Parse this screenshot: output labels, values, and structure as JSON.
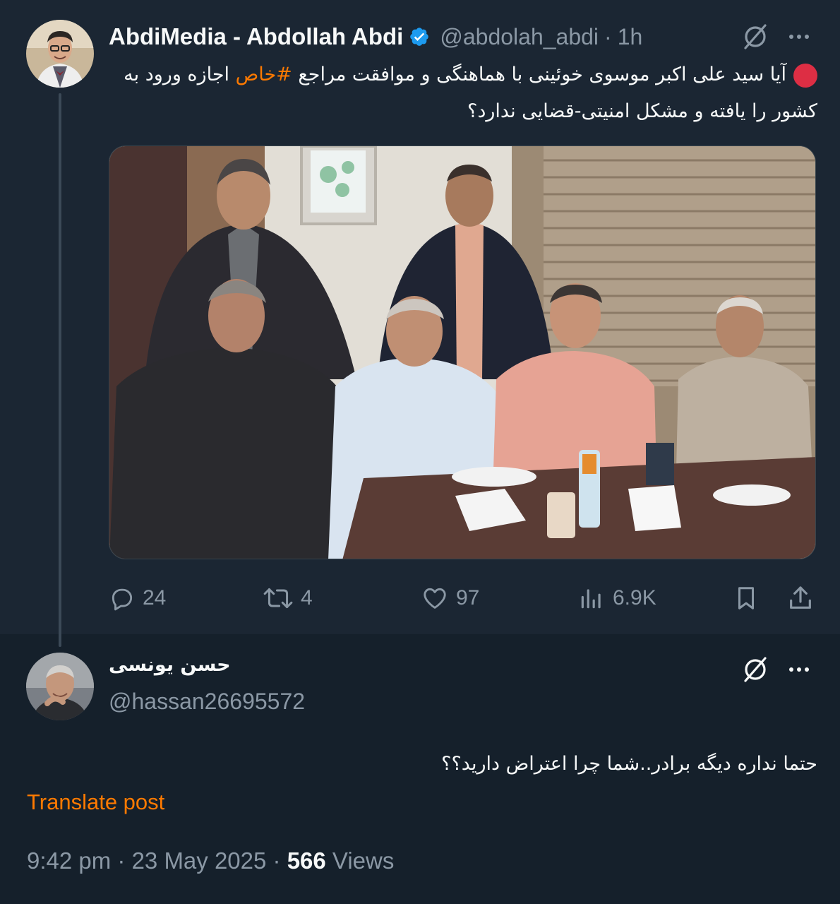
{
  "post": {
    "author_name": "AbdiMedia - Abdollah Abdi",
    "handle": "@abdolah_abdi",
    "separator": "·",
    "time": "1h",
    "text_part1": "آیا سید علی اکبر موسوی خوئینی با هماهنگی و موافقت مراجع ",
    "hashtag": "#خاص",
    "text_part2": " اجازه ورود به کشور را یافته و مشکل امنیتی-قضایی ندارد؟",
    "image_alt": "Six men posing around a conference table",
    "stats": {
      "replies": "24",
      "reposts": "4",
      "likes": "97",
      "views": "6.9K"
    }
  },
  "reply": {
    "author_name": "حسن یونسی",
    "handle": "@hassan26695572",
    "text": "حتما نداره دیگه برادر..شما چرا اعتراض دارید؟؟",
    "translate_label": "Translate post",
    "timestamp": "9:42 pm · 23 May 2025 · ",
    "views_count": "566",
    "views_label": " Views"
  },
  "icons": {
    "verified": "verified-badge-icon",
    "grok": "grok-icon",
    "more": "more-icon",
    "reply": "reply-icon",
    "repost": "repost-icon",
    "like": "like-icon",
    "views": "views-icon",
    "bookmark": "bookmark-icon",
    "share": "share-icon"
  },
  "colors": {
    "background": "#15202b",
    "top_post_background": "#1b2633",
    "accent_verified": "#1d9bf0",
    "hashtag": "#ff7a00",
    "translate_link": "#ff7a00",
    "secondary_text": "#8b98a5",
    "red_dot": "#dd2e44"
  }
}
